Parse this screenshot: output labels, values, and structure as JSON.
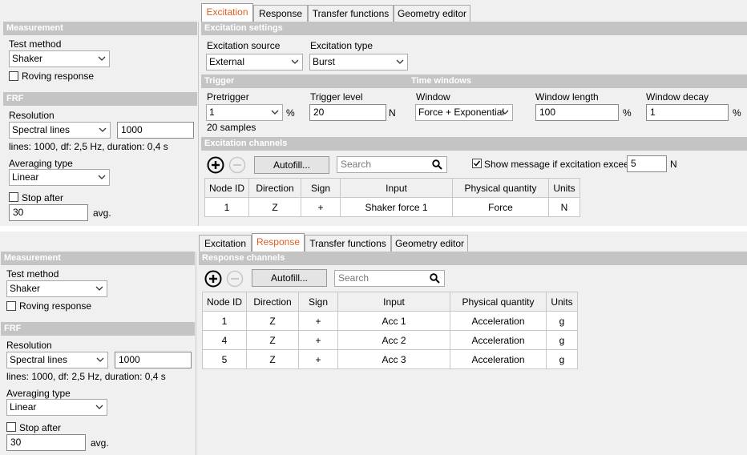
{
  "top": {
    "tabs": [
      {
        "label": "Excitation",
        "active": true
      },
      {
        "label": "Response"
      },
      {
        "label": "Transfer functions"
      },
      {
        "label": "Geometry editor"
      }
    ],
    "left": {
      "measurement_header": "Measurement",
      "test_method_label": "Test method",
      "test_method_value": "Shaker",
      "roving_label": "Roving response",
      "frf_header": "FRF",
      "resolution_label": "Resolution",
      "resolution_value": "Spectral lines",
      "lines_value": "1000",
      "info": "lines: 1000, df: 2,5 Hz, duration: 0,4 s",
      "averaging_label": "Averaging type",
      "averaging_value": "Linear",
      "stop_after_label": "Stop after",
      "stop_after_value": "30",
      "avg_unit": "avg."
    },
    "excitation_settings": {
      "header": "Excitation settings",
      "source_label": "Excitation source",
      "source_value": "External",
      "type_label": "Excitation type",
      "type_value": "Burst"
    },
    "trigger": {
      "header": "Trigger",
      "pretrigger_label": "Pretrigger",
      "pretrigger_value": "1",
      "pretrigger_unit": "%",
      "samples": "20 samples",
      "level_label": "Trigger level",
      "level_value": "20",
      "level_unit": "N"
    },
    "time_windows": {
      "header": "Time windows",
      "window_label": "Window",
      "window_value": "Force + Exponential",
      "length_label": "Window length",
      "length_value": "100",
      "length_unit": "%",
      "decay_label": "Window decay",
      "decay_value": "1",
      "decay_unit": "%"
    },
    "excitation_channels": {
      "header": "Excitation channels",
      "autofill": "Autofill...",
      "search_placeholder": "Search",
      "show_message_label": "Show message if excitation exceeds",
      "threshold_value": "5",
      "threshold_unit": "N",
      "columns": [
        "Node ID",
        "Direction",
        "Sign",
        "Input",
        "Physical quantity",
        "Units"
      ],
      "rows": [
        [
          "1",
          "Z",
          "+",
          "Shaker force 1",
          "Force",
          "N"
        ]
      ]
    }
  },
  "bottom": {
    "tabs": [
      {
        "label": "Excitation"
      },
      {
        "label": "Response",
        "active": true
      },
      {
        "label": "Transfer functions"
      },
      {
        "label": "Geometry editor"
      }
    ],
    "left": {
      "measurement_header": "Measurement",
      "test_method_label": "Test method",
      "test_method_value": "Shaker",
      "roving_label": "Roving response",
      "frf_header": "FRF",
      "resolution_label": "Resolution",
      "resolution_value": "Spectral lines",
      "lines_value": "1000",
      "info": "lines: 1000, df: 2,5 Hz, duration: 0,4 s",
      "averaging_label": "Averaging type",
      "averaging_value": "Linear",
      "stop_after_label": "Stop after",
      "stop_after_value": "30",
      "avg_unit": "avg."
    },
    "response_channels": {
      "header": "Response channels",
      "autofill": "Autofill...",
      "search_placeholder": "Search",
      "columns": [
        "Node ID",
        "Direction",
        "Sign",
        "Input",
        "Physical quantity",
        "Units"
      ],
      "rows": [
        [
          "1",
          "Z",
          "+",
          "Acc 1",
          "Acceleration",
          "g"
        ],
        [
          "4",
          "Z",
          "+",
          "Acc 2",
          "Acceleration",
          "g"
        ],
        [
          "5",
          "Z",
          "+",
          "Acc 3",
          "Acceleration",
          "g"
        ]
      ]
    }
  },
  "icons": {
    "add": "plus-circle-icon",
    "remove": "minus-circle-icon",
    "search": "magnifier-icon",
    "dropdown": "chevron-down-icon",
    "check": "checkmark-icon"
  },
  "colors": {
    "active_tab_text": "#e05e20",
    "section_header": "#c4c4c4",
    "panel_bg": "#f0f0f0"
  }
}
